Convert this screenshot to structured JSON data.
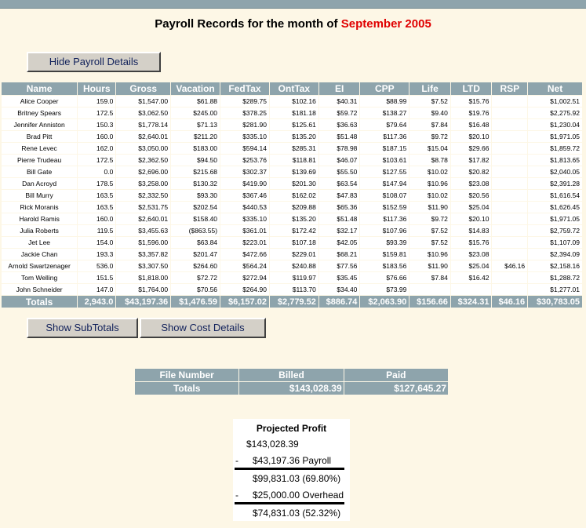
{
  "title": {
    "prefix": "Payroll Records for the month of ",
    "period": "September 2005"
  },
  "buttons": {
    "hide_details": "Hide Payroll Details",
    "show_subtotals": "Show SubTotals",
    "show_cost": "Show Cost Details"
  },
  "payroll": {
    "headers": [
      "Name",
      "Hours",
      "Gross",
      "Vacation",
      "FedTax",
      "OntTax",
      "EI",
      "CPP",
      "Life",
      "LTD",
      "RSP",
      "Net"
    ],
    "rows": [
      [
        "Alice Cooper",
        "159.0",
        "$1,547.00",
        "$61.88",
        "$289.75",
        "$102.16",
        "$40.31",
        "$88.99",
        "$7.52",
        "$15.76",
        "",
        "$1,002.51"
      ],
      [
        "Britney Spears",
        "172.5",
        "$3,062.50",
        "$245.00",
        "$378.25",
        "$181.18",
        "$59.72",
        "$138.27",
        "$9.40",
        "$19.76",
        "",
        "$2,275.92"
      ],
      [
        "Jennifer Anniston",
        "150.3",
        "$1,778.14",
        "$71.13",
        "$281.90",
        "$125.61",
        "$36.63",
        "$79.64",
        "$7.84",
        "$16.48",
        "",
        "$1,230.04"
      ],
      [
        "Brad Pitt",
        "160.0",
        "$2,640.01",
        "$211.20",
        "$335.10",
        "$135.20",
        "$51.48",
        "$117.36",
        "$9.72",
        "$20.10",
        "",
        "$1,971.05"
      ],
      [
        "Rene Levec",
        "162.0",
        "$3,050.00",
        "$183.00",
        "$594.14",
        "$285.31",
        "$78.98",
        "$187.15",
        "$15.04",
        "$29.66",
        "",
        "$1,859.72"
      ],
      [
        "Pierre Trudeau",
        "172.5",
        "$2,362.50",
        "$94.50",
        "$253.76",
        "$118.81",
        "$46.07",
        "$103.61",
        "$8.78",
        "$17.82",
        "",
        "$1,813.65"
      ],
      [
        "Bill Gate",
        "0.0",
        "$2,696.00",
        "$215.68",
        "$302.37",
        "$139.69",
        "$55.50",
        "$127.55",
        "$10.02",
        "$20.82",
        "",
        "$2,040.05"
      ],
      [
        "Dan Acroyd",
        "178.5",
        "$3,258.00",
        "$130.32",
        "$419.90",
        "$201.30",
        "$63.54",
        "$147.94",
        "$10.96",
        "$23.08",
        "",
        "$2,391.28"
      ],
      [
        "Bill Murry",
        "163.5",
        "$2,332.50",
        "$93.30",
        "$367.46",
        "$162.02",
        "$47.83",
        "$108.07",
        "$10.02",
        "$20.56",
        "",
        "$1,616.54"
      ],
      [
        "Rick Moranis",
        "163.5",
        "$2,531.75",
        "$202.54",
        "$440.53",
        "$209.88",
        "$65.36",
        "$152.59",
        "$11.90",
        "$25.04",
        "",
        "$1,626.45"
      ],
      [
        "Harold Ramis",
        "160.0",
        "$2,640.01",
        "$158.40",
        "$335.10",
        "$135.20",
        "$51.48",
        "$117.36",
        "$9.72",
        "$20.10",
        "",
        "$1,971.05"
      ],
      [
        "Julia Roberts",
        "119.5",
        "$3,455.63",
        "($863.55)",
        "$361.01",
        "$172.42",
        "$32.17",
        "$107.96",
        "$7.52",
        "$14.83",
        "",
        "$2,759.72"
      ],
      [
        "Jet Lee",
        "154.0",
        "$1,596.00",
        "$63.84",
        "$223.01",
        "$107.18",
        "$42.05",
        "$93.39",
        "$7.52",
        "$15.76",
        "",
        "$1,107.09"
      ],
      [
        "Jackie Chan",
        "193.3",
        "$3,357.82",
        "$201.47",
        "$472.66",
        "$229.01",
        "$68.21",
        "$159.81",
        "$10.96",
        "$23.08",
        "",
        "$2,394.09"
      ],
      [
        "Arnold Swartzenager",
        "536.0",
        "$3,307.50",
        "$264.60",
        "$564.24",
        "$240.88",
        "$77.56",
        "$183.56",
        "$11.90",
        "$25.04",
        "$46.16",
        "$2,158.16"
      ],
      [
        "Tom Welling",
        "151.5",
        "$1,818.00",
        "$72.72",
        "$272.94",
        "$119.97",
        "$35.45",
        "$76.66",
        "$7.84",
        "$16.42",
        "",
        "$1,288.72"
      ],
      [
        "John Schneider",
        "147.0",
        "$1,764.00",
        "$70.56",
        "$264.90",
        "$113.70",
        "$34.40",
        "$73.99",
        "",
        "",
        "",
        "$1,277.01"
      ]
    ],
    "totals": [
      "Totals",
      "2,943.0",
      "$43,197.36",
      "$1,476.59",
      "$6,157.02",
      "$2,779.52",
      "$886.74",
      "$2,063.90",
      "$156.66",
      "$324.31",
      "$46.16",
      "$30,783.05"
    ]
  },
  "file_table": {
    "headers": [
      "File Number",
      "Billed",
      "Paid"
    ],
    "totals": [
      "Totals",
      "$143,028.39",
      "$127,645.27"
    ]
  },
  "profit": {
    "title": "Projected Profit",
    "billed": "$143,028.39",
    "payroll_sign": "-",
    "payroll_amount": "$43,197.36",
    "payroll_label": "Payroll",
    "subtotal": "$99,831.03 (69.80%)",
    "overhead_sign": "-",
    "overhead_amount": "$25,000.00",
    "overhead_label": "Overhead",
    "net": "$74,831.03 (52.32%)"
  }
}
